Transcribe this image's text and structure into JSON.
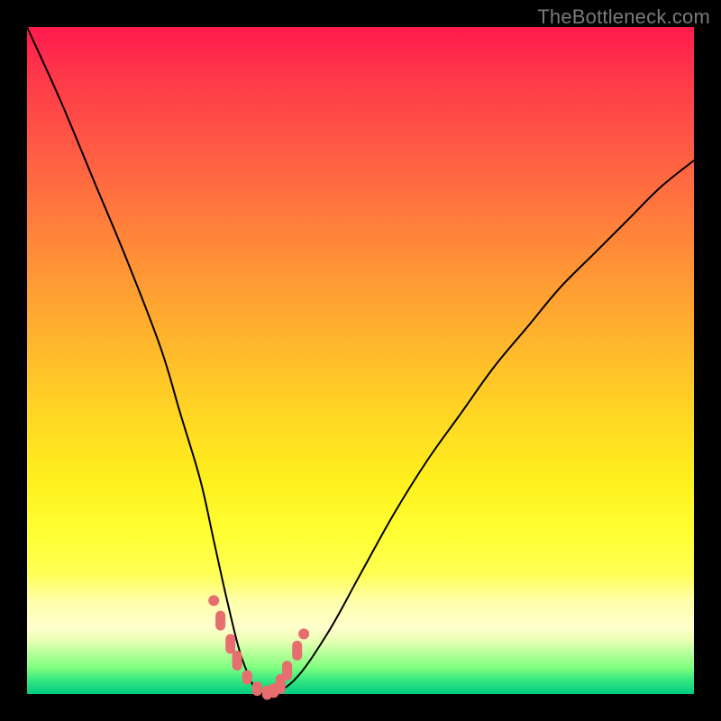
{
  "watermark": "TheBottleneck.com",
  "colors": {
    "marker": "#e86d6f",
    "curve": "#000000",
    "frame": "#000000"
  },
  "chart_data": {
    "type": "line",
    "title": "",
    "xlabel": "",
    "ylabel": "",
    "xlim": [
      0,
      100
    ],
    "ylim": [
      0,
      100
    ],
    "grid": false,
    "legend": false,
    "series": [
      {
        "name": "bottleneck-curve",
        "x": [
          0,
          5,
          10,
          15,
          20,
          23,
          26,
          28,
          30,
          32,
          34,
          36,
          40,
          45,
          50,
          55,
          60,
          65,
          70,
          75,
          80,
          85,
          90,
          95,
          100
        ],
        "y": [
          100,
          89,
          77,
          65,
          52,
          42,
          32,
          23,
          14,
          6,
          1,
          0,
          2,
          9,
          18,
          27,
          35,
          42,
          49,
          55,
          61,
          66,
          71,
          76,
          80
        ]
      }
    ],
    "markers": {
      "name": "near-minimum-markers",
      "x": [
        29.0,
        30.5,
        31.5,
        33.0,
        34.5,
        36.0,
        37.0,
        38.0,
        39.0,
        40.5
      ],
      "y": [
        11.0,
        7.5,
        5.0,
        2.5,
        0.8,
        0.2,
        0.5,
        1.5,
        3.5,
        6.5
      ]
    },
    "minimum": {
      "x": 35.5,
      "y": 0
    }
  }
}
